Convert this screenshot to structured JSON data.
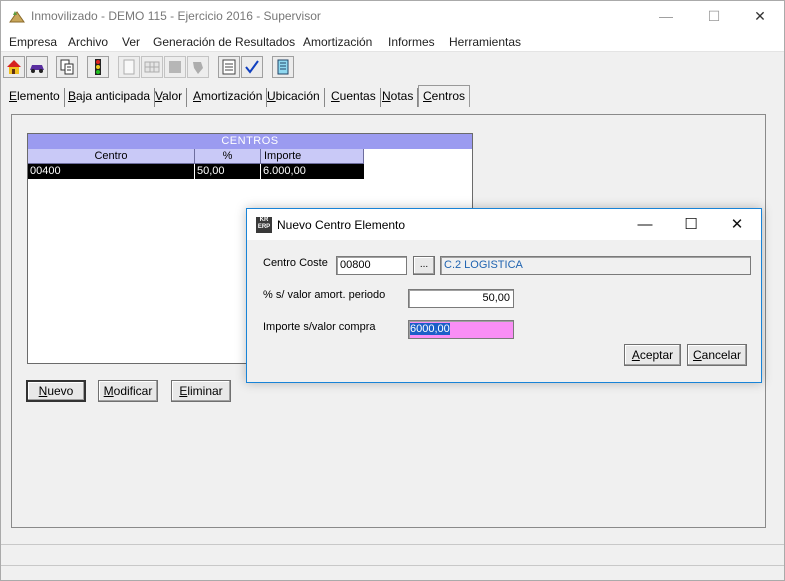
{
  "window": {
    "title": "Inmovilizado - DEMO 115 - Ejercicio 2016 - Supervisor",
    "minimize": "—",
    "maximize": "☐",
    "close": "✕"
  },
  "menu": [
    "Empresa",
    "Archivo",
    "Ver",
    "Generación de Resultados",
    "Amortización",
    "Informes",
    "Herramientas"
  ],
  "tabs": [
    {
      "label": "Elemento",
      "u": "E",
      "rest": "lemento"
    },
    {
      "label": "Baja anticipada",
      "u": "B",
      "rest": "aja anticipada"
    },
    {
      "label": "Valor",
      "u": "V",
      "rest": "alor"
    },
    {
      "label": "Amortización",
      "u": "A",
      "rest": "mortización"
    },
    {
      "label": "Ubicación",
      "u": "U",
      "rest": "bicación"
    },
    {
      "label": "Cuentas",
      "u": "C",
      "rest": "uentas"
    },
    {
      "label": "Notas",
      "u": "N",
      "rest": "otas"
    },
    {
      "label": "Centros",
      "u": "C",
      "rest": "entros"
    }
  ],
  "grid": {
    "title": "CENTROS",
    "columns": [
      "Centro",
      "%",
      "Importe"
    ],
    "rows": [
      [
        "00400",
        "50,00",
        "6.000,00"
      ]
    ]
  },
  "buttons": {
    "nuevo": {
      "u": "N",
      "rest": "uevo"
    },
    "modificar": {
      "u": "M",
      "rest": "odificar"
    },
    "eliminar": {
      "u": "E",
      "rest": "liminar"
    }
  },
  "dialog": {
    "title": "Nuevo Centro Elemento",
    "minimize": "—",
    "maximize": "☐",
    "close": "✕",
    "centro_coste_label": "Centro Coste",
    "centro_coste_value": "00800",
    "browse": "...",
    "centro_coste_desc": "C.2 LOGISTICA",
    "porcentaje_label": "% s/ valor amort. periodo",
    "porcentaje_value": "50,00",
    "importe_label": "Importe s/valor compra",
    "importe_value": "6000,00",
    "aceptar": {
      "u": "A",
      "rest": "ceptar"
    },
    "cancelar": {
      "u": "C",
      "rest": "ancelar"
    }
  }
}
